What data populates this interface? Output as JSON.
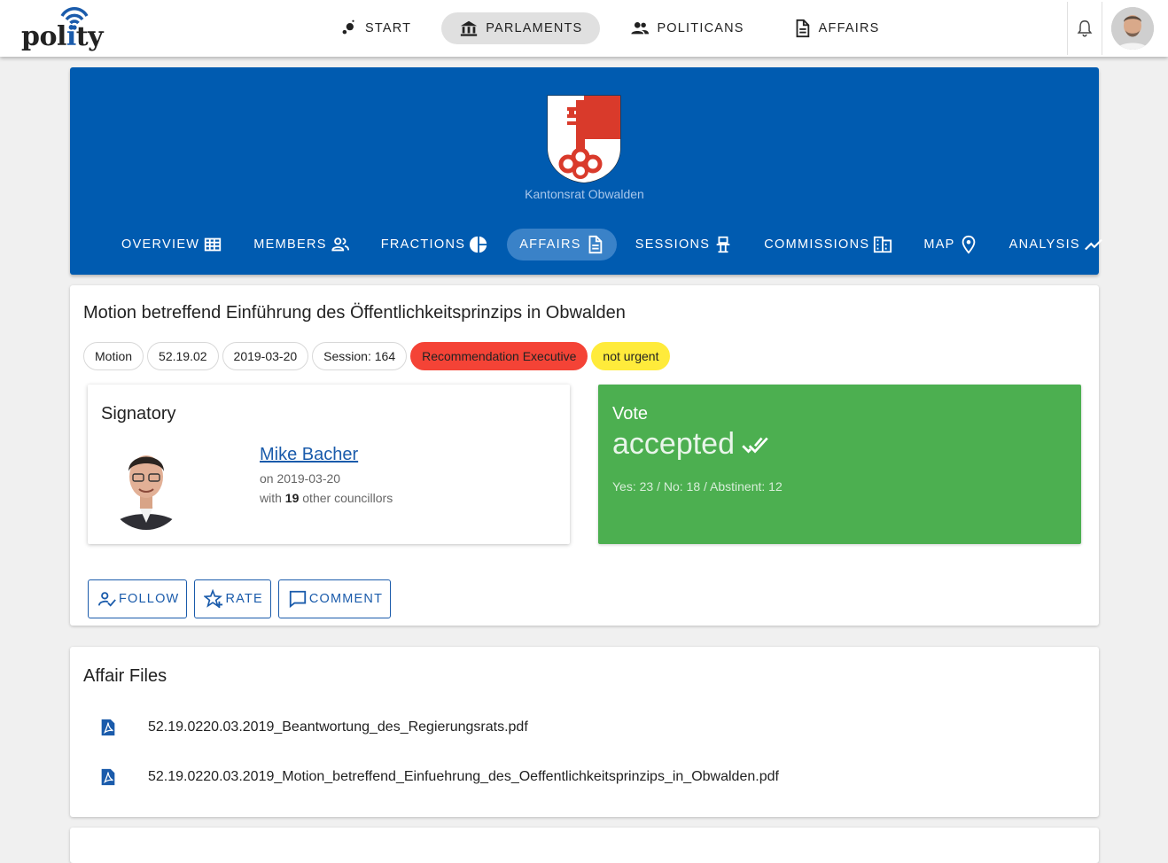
{
  "app": {
    "logo_text_pre": "pol",
    "logo_text_i": "i",
    "logo_text_post": "ty",
    "nav": [
      {
        "label": "START",
        "icon": "start-icon"
      },
      {
        "label": "PARLAMENTS",
        "icon": "parliament-icon",
        "active": true
      },
      {
        "label": "POLITICANS",
        "icon": "people-icon"
      },
      {
        "label": "AFFAIRS",
        "icon": "document-icon"
      }
    ]
  },
  "parliament": {
    "name": "Kantonsrat Obwalden",
    "tabs": [
      {
        "label": "OVERVIEW",
        "icon": "grid-icon"
      },
      {
        "label": "MEMBERS",
        "icon": "members-icon"
      },
      {
        "label": "FRACTIONS",
        "icon": "pie-icon"
      },
      {
        "label": "AFFAIRS",
        "icon": "document-icon",
        "active": true
      },
      {
        "label": "SESSIONS",
        "icon": "seat-icon"
      },
      {
        "label": "COMMISSIONS",
        "icon": "building-icon"
      },
      {
        "label": "MAP",
        "icon": "map-pin-icon"
      },
      {
        "label": "ANALYSIS",
        "icon": "trend-icon"
      }
    ]
  },
  "affair": {
    "title": "Motion betreffend Einführung des Öffentlichkeitsprinzips in Obwalden",
    "chips": {
      "type": "Motion",
      "number": "52.19.02",
      "date": "2019-03-20",
      "session": "Session: 164",
      "recommendation": "Recommendation Executive",
      "urgency": "not urgent"
    },
    "signatory": {
      "heading": "Signatory",
      "name": "Mike Bacher",
      "date": "on 2019-03-20",
      "with_prefix": "with",
      "with_count": "19",
      "with_suffix": "other councillors"
    },
    "vote": {
      "heading": "Vote",
      "result": "accepted",
      "stats": "Yes: 23 / No: 18 / Abstinent: 12"
    },
    "actions": {
      "follow": "FOLLOW",
      "rate": "RATE",
      "comment": "COMMENT"
    }
  },
  "files": {
    "heading": "Affair Files",
    "items": [
      "52.19.0220.03.2019_Beantwortung_des_Regierungsrats.pdf",
      "52.19.0220.03.2019_Motion_betreffend_Einfuehrung_des_Oeffentlichkeitsprinzips_in_Obwalden.pdf"
    ]
  },
  "colors": {
    "brand_blue": "#005bb0",
    "link_blue": "#1a5bab",
    "vote_green": "#4caf50",
    "chip_red": "#f44336",
    "chip_yellow": "#ffeb3b"
  }
}
